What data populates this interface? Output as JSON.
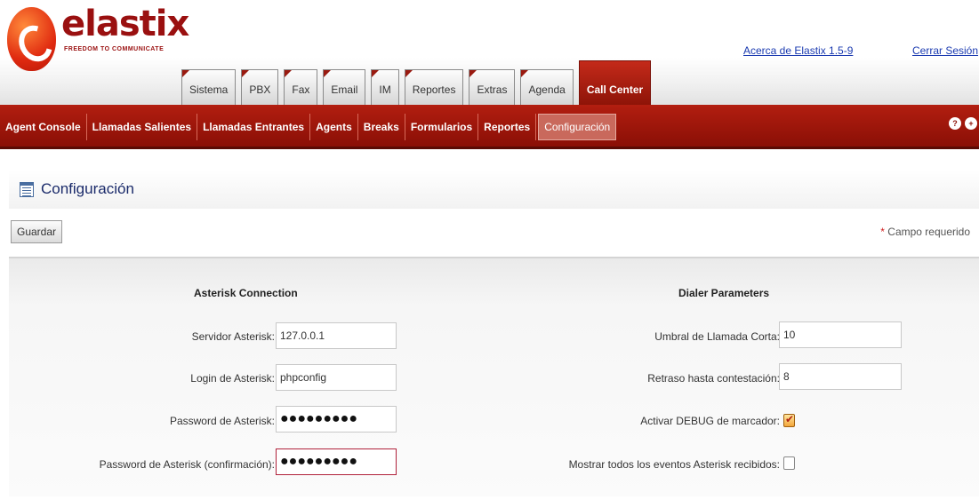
{
  "logo": {
    "name": "elastix",
    "tagline": "FREEDOM TO COMMUNICATE"
  },
  "header": {
    "about_link": "Acerca de Elastix 1.5-9",
    "logout_link": "Cerrar Sesión"
  },
  "tabs": [
    "Sistema",
    "PBX",
    "Fax",
    "Email",
    "IM",
    "Reportes",
    "Extras",
    "Agenda",
    "Call Center"
  ],
  "active_tab": "Call Center",
  "submenu": [
    "Agent Console",
    "Llamadas Salientes",
    "Llamadas Entrantes",
    "Agents",
    "Breaks",
    "Formularios",
    "Reportes",
    "Configuración"
  ],
  "active_submenu": "Configuración",
  "help_icons": [
    "help-icon",
    "plus-icon"
  ],
  "page": {
    "title": "Configuración",
    "save_button": "Guardar",
    "required_star": "*",
    "required_note": "Campo requerido"
  },
  "asterisk": {
    "section_title": "Asterisk Connection",
    "server_label": "Servidor Asterisk:",
    "server_value": "127.0.0.1",
    "login_label": "Login de Asterisk:",
    "login_value": "phpconfig",
    "password_label": "Password de Asterisk:",
    "password_value": "●●●●●●●●●",
    "password_confirm_label": "Password de Asterisk (confirmación):",
    "password_confirm_value": "●●●●●●●●●"
  },
  "dialer": {
    "section_title": "Dialer Parameters",
    "short_call_label": "Umbral de Llamada Corta:",
    "short_call_value": "10",
    "answer_delay_label": "Retraso hasta contestación:",
    "answer_delay_value": "8",
    "debug_label": "Activar DEBUG de marcador:",
    "debug_checked": true,
    "all_events_label": "Mostrar todos los eventos Asterisk recibidos:",
    "all_events_checked": false
  },
  "colors": {
    "brand_red": "#9a1010",
    "menu_red": "#b21e10",
    "link_blue": "#1a3ab0"
  }
}
